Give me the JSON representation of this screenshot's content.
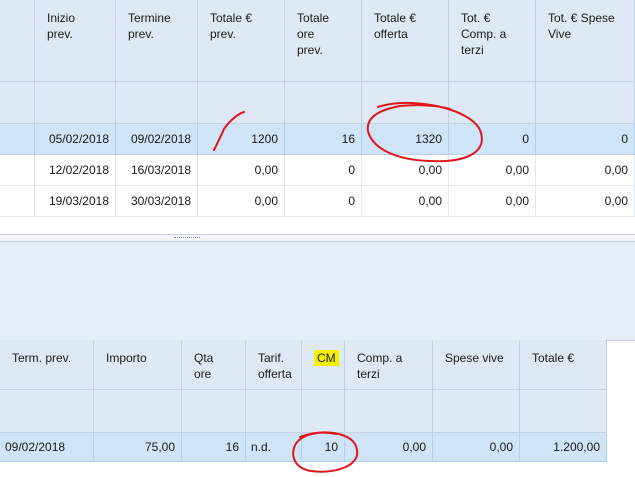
{
  "top_grid": {
    "headers": [
      "Inizio\nprev.",
      "Termine\nprev.",
      "Totale €\nprev.",
      "Totale ore\nprev.",
      "Totale €\nofferta",
      "Tot. €\nComp. a\nterzi",
      "Tot. € Spese\nVive"
    ],
    "rows": [
      [
        "05/02/2018",
        "09/02/2018",
        "1200",
        "16",
        "1320",
        "0",
        "0"
      ],
      [
        "12/02/2018",
        "16/03/2018",
        "0,00",
        "0",
        "0,00",
        "0,00",
        "0,00"
      ],
      [
        "19/03/2018",
        "30/03/2018",
        "0,00",
        "0",
        "0,00",
        "0,00",
        "0,00"
      ]
    ]
  },
  "bottom_grid": {
    "headers": [
      "Term. prev.",
      "Importo",
      "Qta ore",
      "Tarif.\nofferta",
      "CM",
      "Comp. a\nterzi",
      "Spese vive",
      "Totale €"
    ],
    "rows": [
      [
        "09/02/2018",
        "75,00",
        "16",
        "n.d.",
        "10",
        "0,00",
        "0,00",
        "1.200,00"
      ]
    ]
  },
  "annotation_color": "#e0151b",
  "highlight_color": "#f4f000"
}
